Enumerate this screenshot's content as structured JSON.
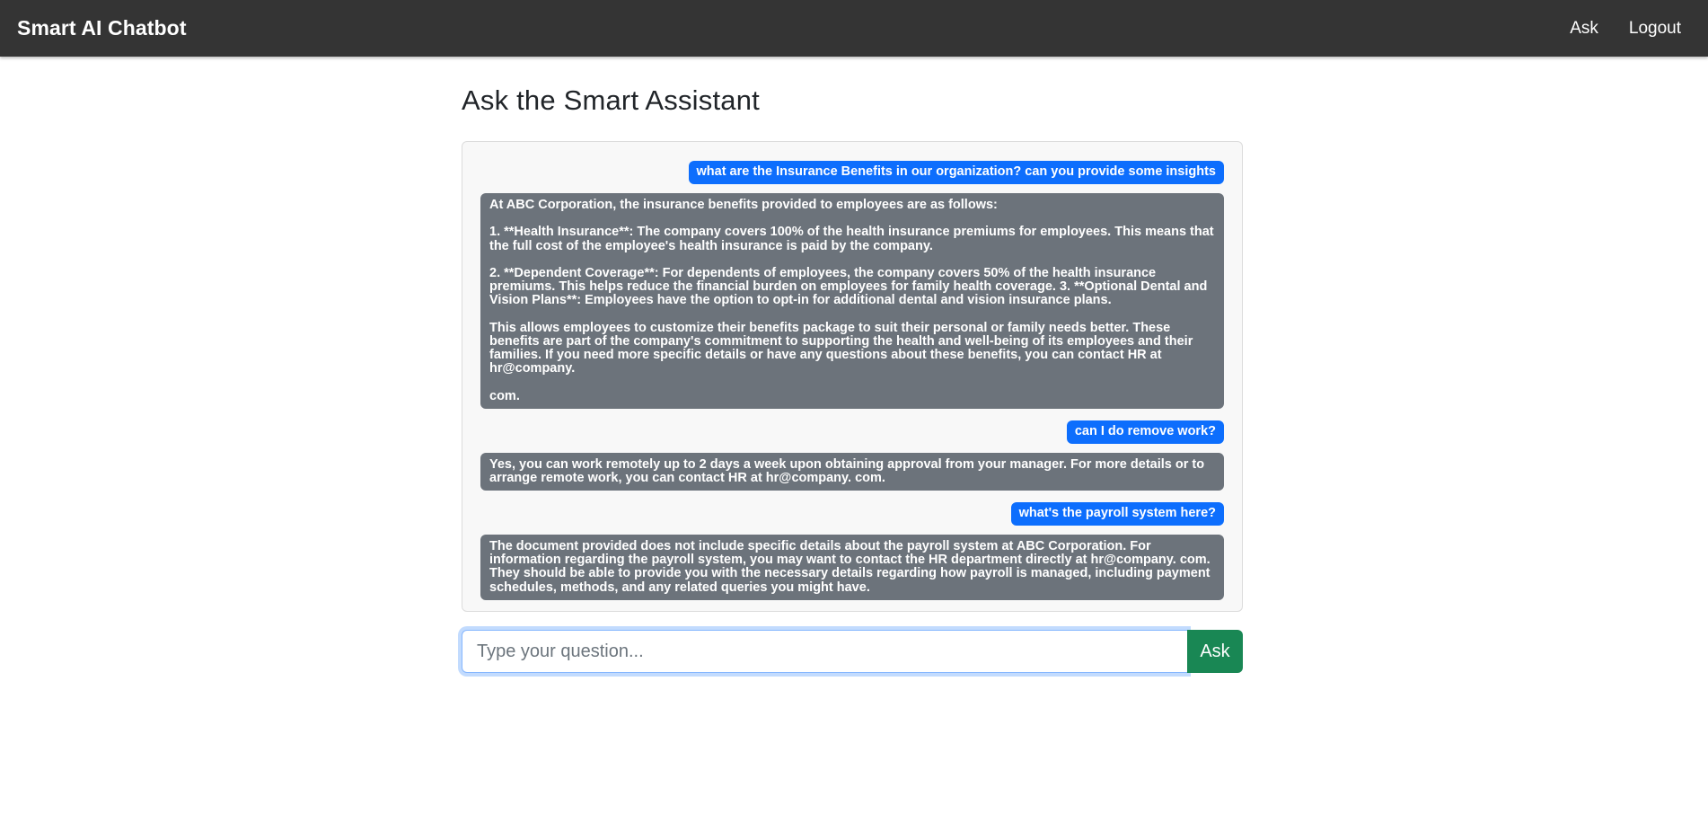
{
  "navbar": {
    "brand": "Smart AI Chatbot",
    "links": [
      "Ask",
      "Logout"
    ]
  },
  "page": {
    "title": "Ask the Smart Assistant"
  },
  "chat": {
    "messages": [
      {
        "role": "user",
        "text": "what are the Insurance Benefits in our organization? can you provide some insights"
      },
      {
        "role": "bot",
        "text": "At ABC Corporation, the insurance benefits provided to employees are as follows:\n\n1. **Health Insurance**: The company covers 100% of the health insurance premiums for employees. This means that the full cost of the employee's health insurance is paid by the company.\n\n2. **Dependent Coverage**: For dependents of employees, the company covers 50% of the health insurance premiums. This helps reduce the financial burden on employees for family health coverage. 3. **Optional Dental and Vision Plans**: Employees have the option to opt-in for additional dental and vision insurance plans.\n\nThis allows employees to customize their benefits package to suit their personal or family needs better. These benefits are part of the company's commitment to supporting the health and well-being of its employees and their families. If you need more specific details or have any questions about these benefits, you can contact HR at hr@company.\n\ncom."
      },
      {
        "role": "user",
        "text": "can I do remove work?"
      },
      {
        "role": "bot",
        "text": "Yes, you can work remotely up to 2 days a week upon obtaining approval from your manager. For more details or to arrange remote work, you can contact HR at hr@company. com."
      },
      {
        "role": "user",
        "text": "what's the payroll system here?"
      },
      {
        "role": "bot",
        "text": "The document provided does not include specific details about the payroll system at ABC Corporation. For information regarding the payroll system, you may want to contact the HR department directly at hr@company. com. They should be able to provide you with the necessary details regarding how payroll is managed, including payment schedules, methods, and any related queries you might have."
      }
    ]
  },
  "input": {
    "placeholder": "Type your question...",
    "value": "",
    "ask_label": "Ask"
  },
  "colors": {
    "navbar": "#343434",
    "user_bubble": "#0d6efd",
    "bot_bubble": "#6c737b",
    "ask_button": "#198754"
  }
}
